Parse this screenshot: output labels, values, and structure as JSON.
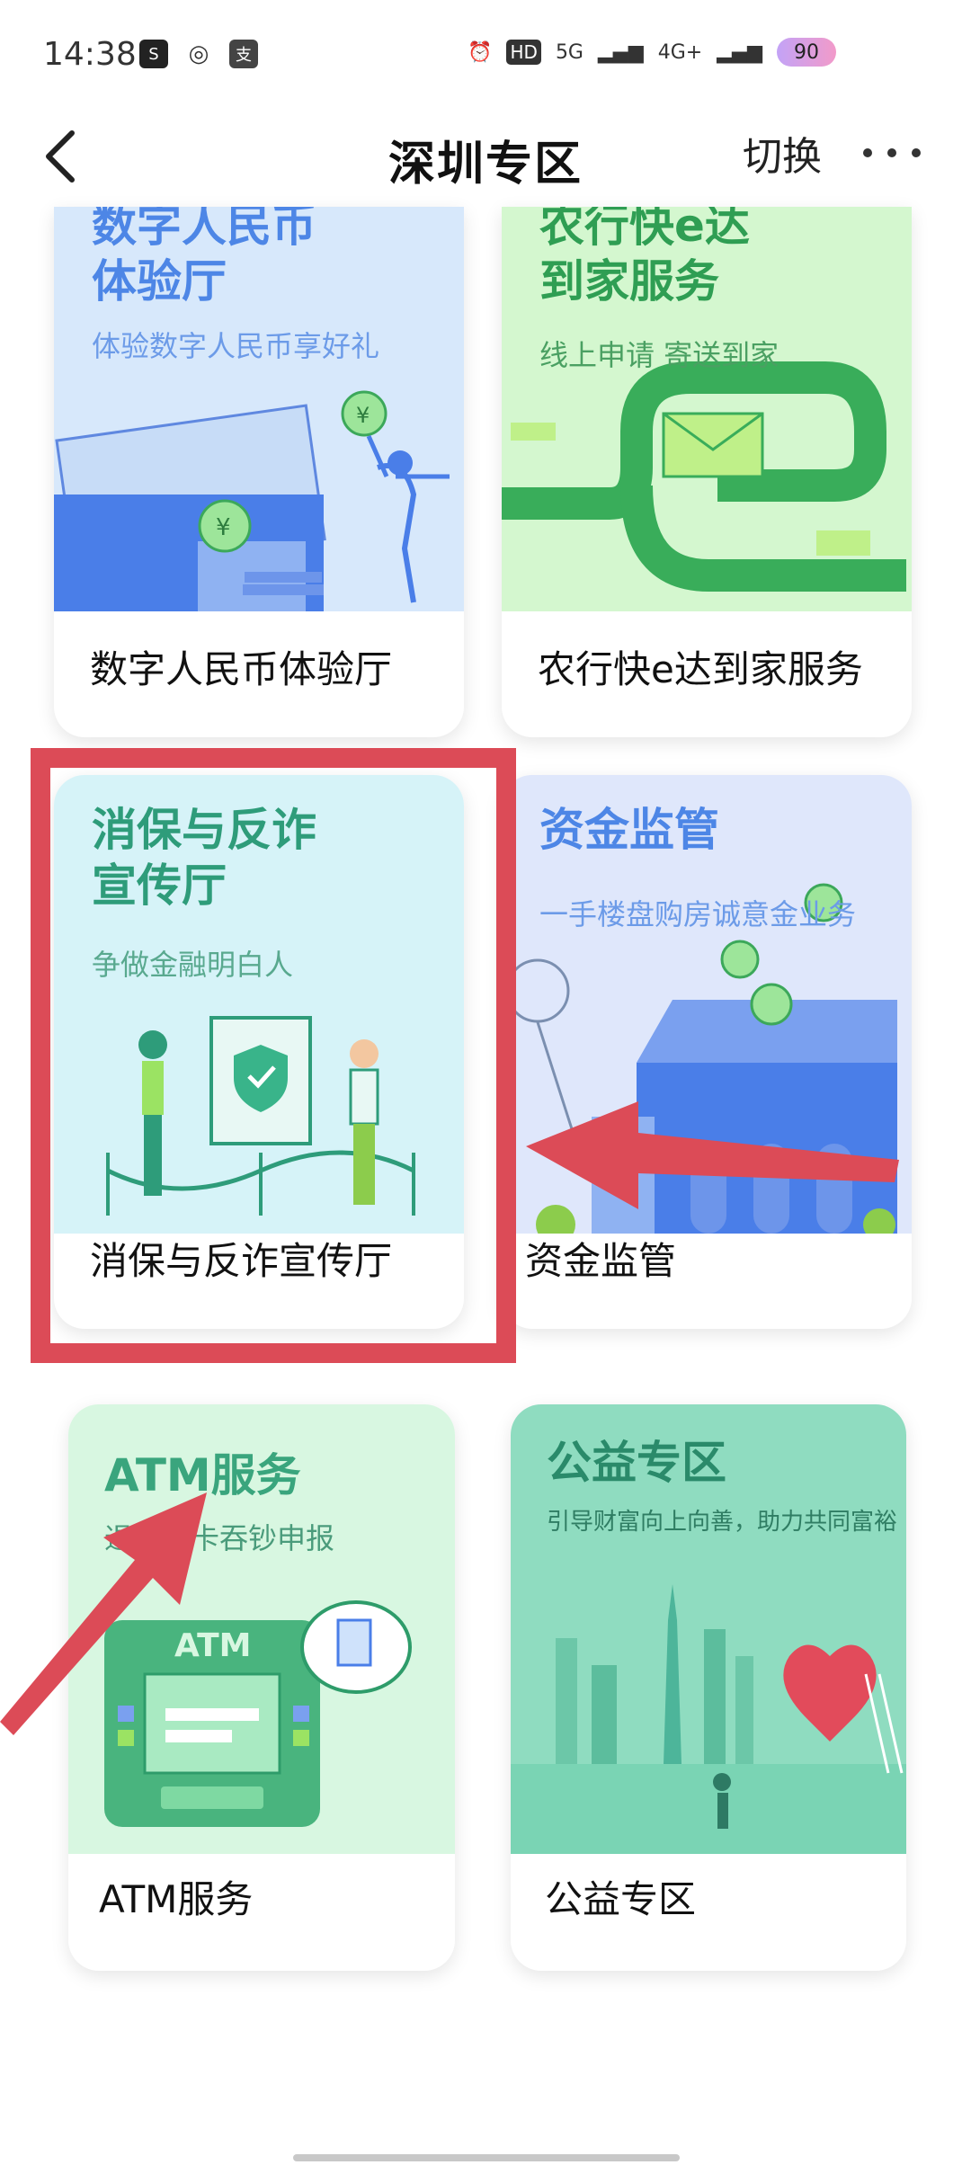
{
  "status": {
    "time": "14:38",
    "battery": "90",
    "network_hd": "HD",
    "network_5g": "5G",
    "network_4g": "4G+"
  },
  "nav": {
    "title": "深圳专区",
    "switch_label": "切换"
  },
  "cards": [
    {
      "banner_title": "数字人民币\n体验厅",
      "banner_sub": "体验数字人民币享好礼",
      "caption": "数字人民币体验厅"
    },
    {
      "banner_title": "农行快e达\n到家服务",
      "banner_sub": "线上申请 寄送到家",
      "caption": "农行快e达到家服务"
    },
    {
      "banner_title": "消保与反诈\n宣传厅",
      "banner_sub": "争做金融明白人",
      "caption": "消保与反诈宣传厅"
    },
    {
      "banner_title": "资金监管",
      "banner_sub": "一手楼盘购房诚意金业务",
      "caption": "资金监管"
    },
    {
      "banner_title": "ATM服务",
      "banner_sub": "退还吞卡吞钞申报",
      "atm_label": "ATM",
      "caption": "ATM服务"
    },
    {
      "banner_title": "公益专区",
      "banner_sub": "引导财富向上向善，助力共同富裕",
      "caption": "公益专区"
    }
  ],
  "colors": {
    "highlight": "#dc4b57",
    "card1_bg": "#d7e8fb",
    "card2_bg": "#d4f7cf",
    "card3_bg": "#d6f3f8",
    "card4_bg": "#dfe7fb",
    "card5_bg": "#d8f7e1",
    "card6_bg": "#8fdcc0"
  }
}
